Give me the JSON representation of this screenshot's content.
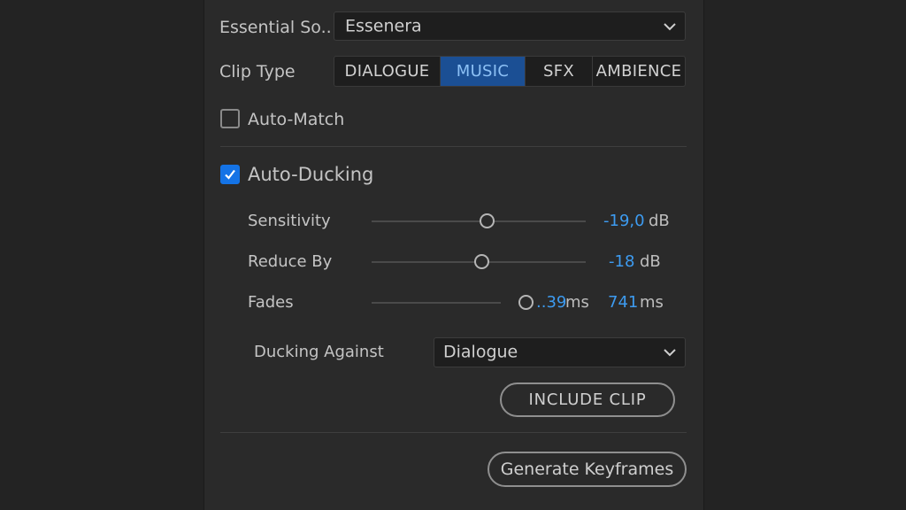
{
  "preset": {
    "label": "Essential So..",
    "value": "Essenera"
  },
  "clip_type": {
    "label": "Clip Type",
    "options": [
      "DIALOGUE",
      "MUSIC",
      "SFX",
      "AMBIENCE"
    ],
    "selected": "MUSIC"
  },
  "auto_match": {
    "label": "Auto-Match",
    "checked": false
  },
  "auto_ducking": {
    "label": "Auto-Ducking",
    "checked": true,
    "sensitivity": {
      "label": "Sensitivity",
      "value": "-19,0",
      "unit": "dB"
    },
    "reduce_by": {
      "label": "Reduce By",
      "value": "-18",
      "unit": "dB"
    },
    "fades": {
      "label": "Fades",
      "value_a": "..39",
      "unit_a": "ms",
      "value_b": "741",
      "unit_b": "ms"
    },
    "ducking_against": {
      "label": "Ducking Against",
      "value": "Dialogue"
    },
    "include_clip_label": "INCLUDE CLIP"
  },
  "generate_keyframes_label": "Generate Keyframes",
  "colors": {
    "accent": "#1473e6",
    "active_segment": "#1b4f94",
    "value_blue": "#3d9bf0"
  }
}
